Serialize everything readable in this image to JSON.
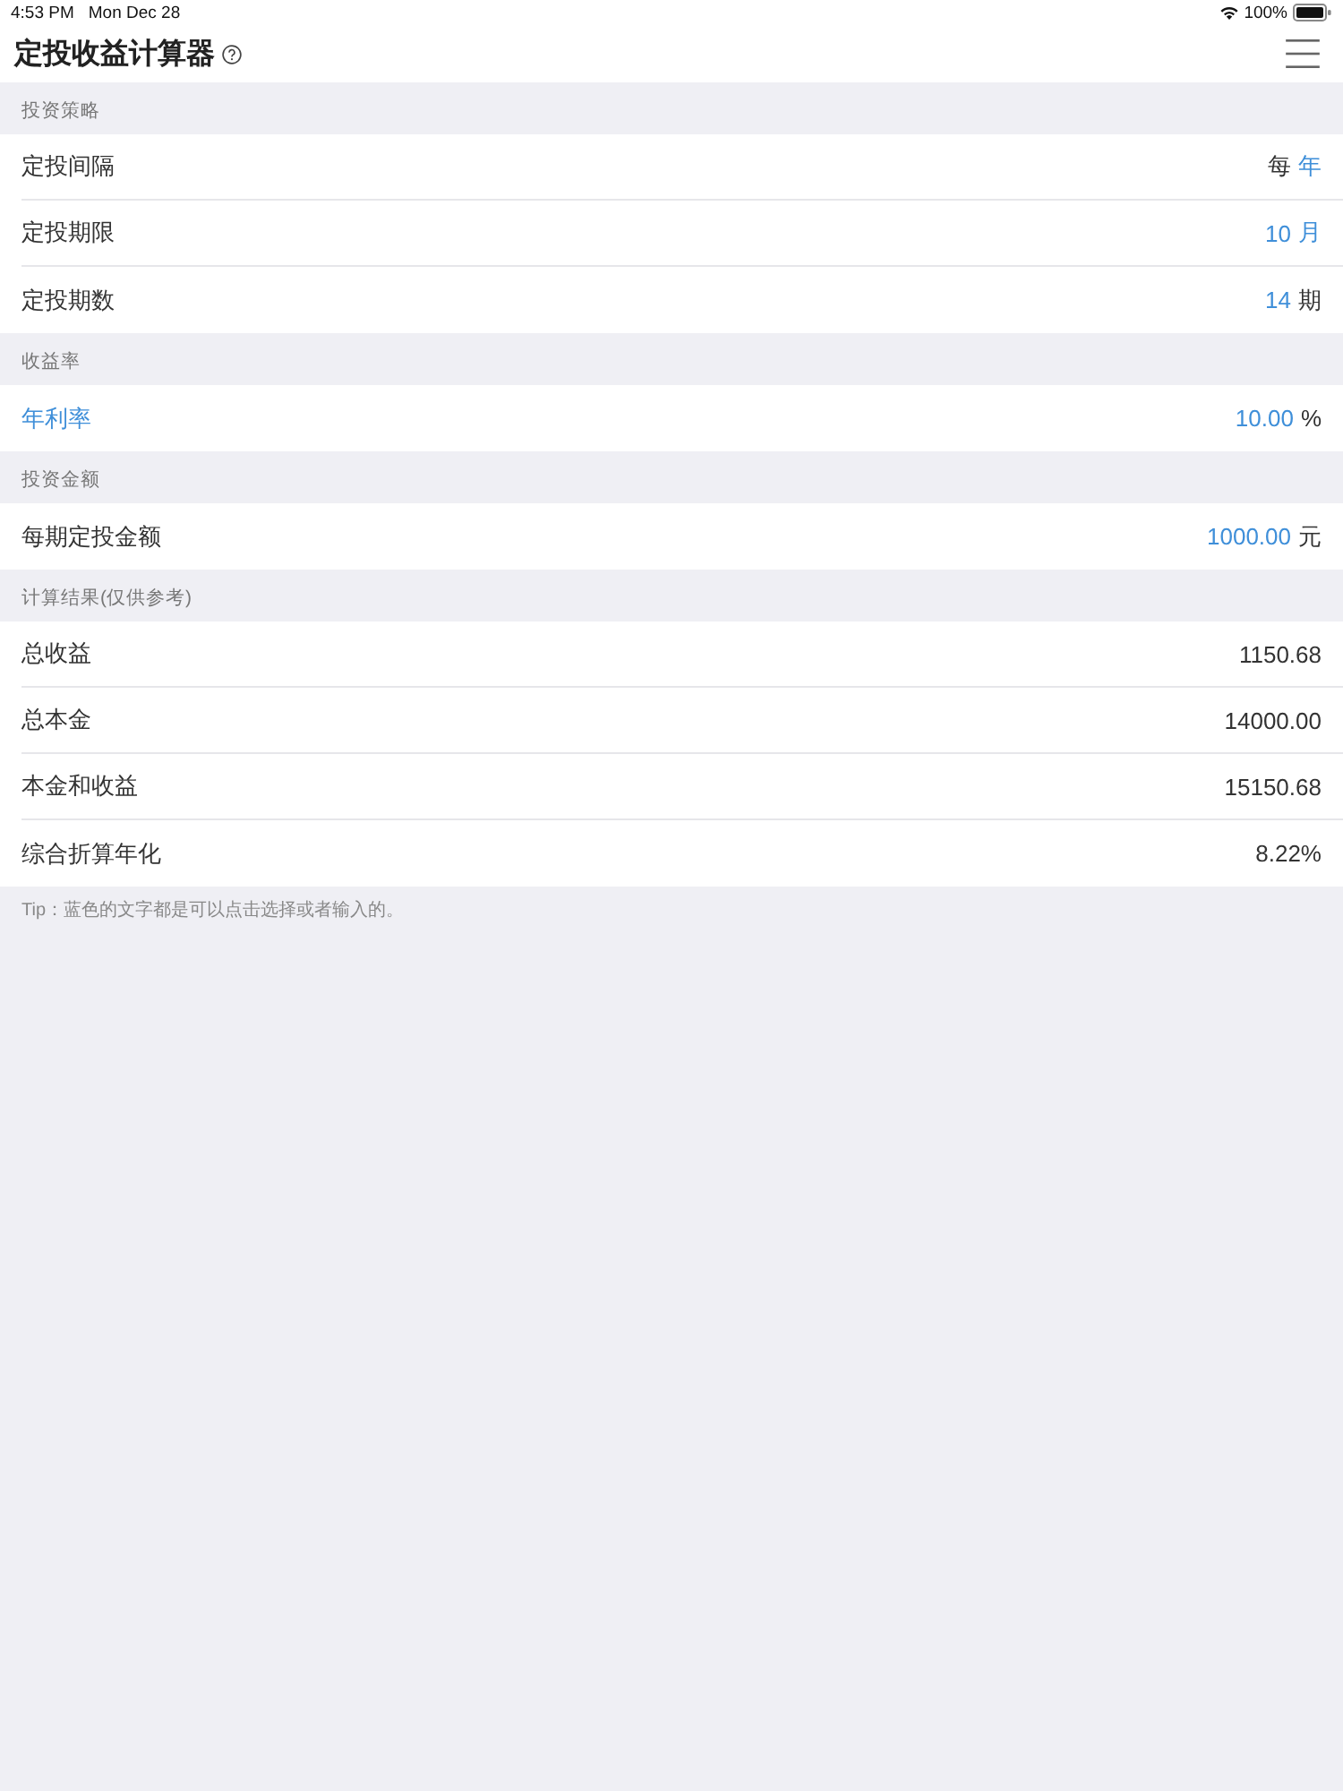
{
  "status_bar": {
    "time": "4:53 PM",
    "date": "Mon Dec 28",
    "battery": "100%"
  },
  "nav": {
    "title": "定投收益计算器"
  },
  "sections": [
    {
      "title": "投资策略",
      "rows": [
        {
          "label": {
            "text": "定投间隔",
            "editable": false
          },
          "value": [
            {
              "text": "每",
              "editable": false
            },
            {
              "text": "年",
              "editable": true
            }
          ]
        },
        {
          "label": {
            "text": "定投期限",
            "editable": false
          },
          "value": [
            {
              "text": "10",
              "editable": true
            },
            {
              "text": "月",
              "editable": true
            }
          ]
        },
        {
          "label": {
            "text": "定投期数",
            "editable": false
          },
          "value": [
            {
              "text": "14",
              "editable": true
            },
            {
              "text": "期",
              "editable": false
            }
          ]
        }
      ]
    },
    {
      "title": "收益率",
      "rows": [
        {
          "label": {
            "text": "年利率",
            "editable": true
          },
          "value": [
            {
              "text": "10.00",
              "editable": true
            },
            {
              "text": "%",
              "editable": false
            }
          ]
        }
      ]
    },
    {
      "title": "投资金额",
      "rows": [
        {
          "label": {
            "text": "每期定投金额",
            "editable": false
          },
          "value": [
            {
              "text": "1000.00",
              "editable": true
            },
            {
              "text": "元",
              "editable": false
            }
          ]
        }
      ]
    },
    {
      "title": "计算结果(仅供参考)",
      "rows": [
        {
          "label": {
            "text": "总收益",
            "editable": false
          },
          "value": [
            {
              "text": "1150.68",
              "editable": false
            }
          ]
        },
        {
          "label": {
            "text": "总本金",
            "editable": false
          },
          "value": [
            {
              "text": "14000.00",
              "editable": false
            }
          ]
        },
        {
          "label": {
            "text": "本金和收益",
            "editable": false
          },
          "value": [
            {
              "text": "15150.68",
              "editable": false
            }
          ]
        },
        {
          "label": {
            "text": "综合折算年化",
            "editable": false
          },
          "value": [
            {
              "text": "8.22%",
              "editable": false
            }
          ]
        }
      ]
    }
  ],
  "tip": "Tip：蓝色的文字都是可以点击选择或者输入的。"
}
